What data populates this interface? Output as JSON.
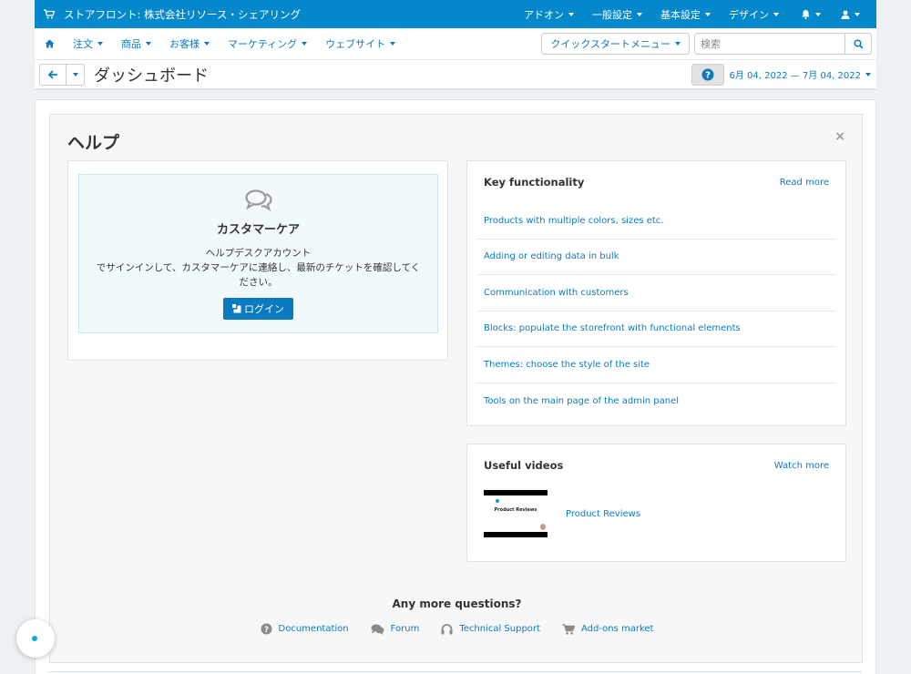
{
  "topbar": {
    "store": "ストアフロント: 株式会社リソース・シェアリング",
    "menus": [
      "アドオン",
      "一般設定",
      "基本設定",
      "デザイン"
    ]
  },
  "nav": {
    "items": [
      "注文",
      "商品",
      "お客様",
      "マーケティング",
      "ウェブサイト"
    ],
    "quickstart": "クイックスタートメニュー",
    "search_placeholder": "検索"
  },
  "titlebar": {
    "title": "ダッシュボード",
    "date_range": "6月 04, 2022 — 7月 04, 2022"
  },
  "help": {
    "title": "ヘルプ",
    "close": "×",
    "care": {
      "title": "カスタマーケア",
      "line1": "ヘルプデスクアカウント",
      "line2": "でサインインして、カスタマーケアに連絡し、最新のチケットを確認してください。",
      "login": "ログイン"
    },
    "key_functionality": {
      "title": "Key functionality",
      "more": "Read more",
      "items": [
        "Products with multiple colors, sizes etc.",
        "Adding or editing data in bulk",
        "Communication with customers",
        "Blocks: populate the storefront with functional elements",
        "Themes: choose the style of the site",
        "Tools on the main page of the admin panel"
      ]
    },
    "useful_videos": {
      "title": "Useful videos",
      "more": "Watch more",
      "video_title": "Product Reviews",
      "thumb_title": "Product Reviews"
    },
    "more_questions": {
      "title": "Any more questions?",
      "links": [
        "Documentation",
        "Forum",
        "Technical Support",
        "Add-ons market"
      ]
    }
  },
  "colors": {
    "topbar": "#0388cc",
    "link": "#0b7bc1",
    "care_bg": "#f1f9fd"
  }
}
